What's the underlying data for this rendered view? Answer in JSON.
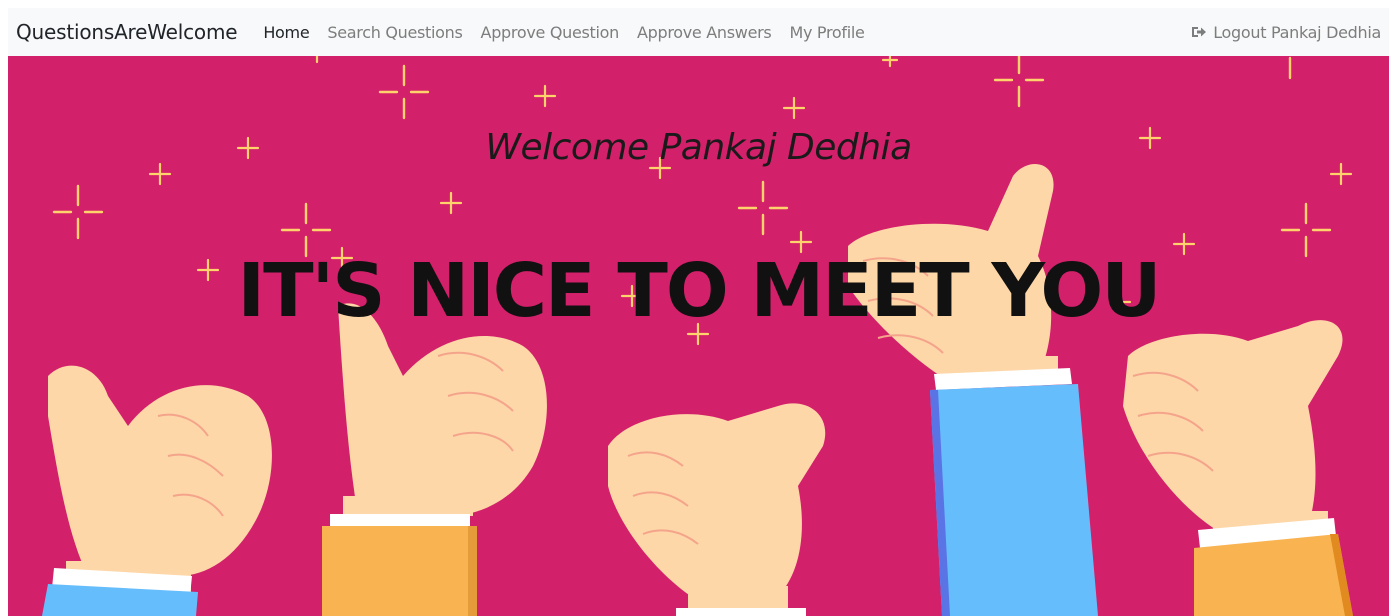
{
  "navbar": {
    "brand": "QuestionsAreWelcome",
    "links": [
      {
        "label": "Home",
        "active": true
      },
      {
        "label": "Search Questions",
        "active": false
      },
      {
        "label": "Approve Question",
        "active": false
      },
      {
        "label": "Approve Answers",
        "active": false
      },
      {
        "label": "My Profile",
        "active": false
      }
    ],
    "logout": {
      "icon": "logout-icon",
      "label": "Logout Pankaj Dedhia"
    }
  },
  "hero": {
    "welcome": "Welcome Pankaj Dedhia",
    "headline": "IT'S NICE TO MEET YOU",
    "image": "thumbs-up-hands-illustration",
    "colors": {
      "background": "#d3206a",
      "sparkle": "#ffd36b",
      "skin": "#fdd7a8",
      "sleeve_orange": "#f9b351",
      "sleeve_blue": "#66bdfc"
    }
  }
}
